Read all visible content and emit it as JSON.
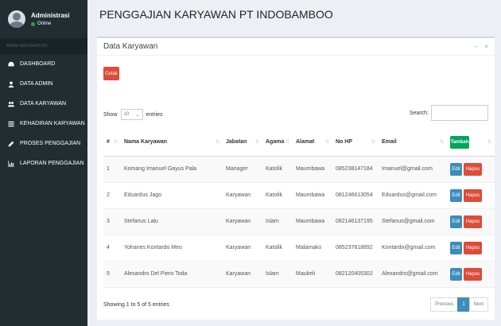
{
  "sidebar": {
    "user": {
      "name": "Administrasi",
      "status": "Online"
    },
    "nav_header": "MAIN NAVIGATION",
    "items": [
      {
        "label": "DASHBOARD",
        "icon": "dashboard-icon"
      },
      {
        "label": "DATA ADMIN",
        "icon": "user-icon"
      },
      {
        "label": "DATA KARYAWAN",
        "icon": "users-icon"
      },
      {
        "label": "KEHADIRAN KARYAWAN",
        "icon": "list-icon"
      },
      {
        "label": "PROSES PENGGAJIAN",
        "icon": "pencil-icon"
      },
      {
        "label": "LAPORAN PENGGAJIAN",
        "icon": "chart-icon"
      }
    ]
  },
  "header": {
    "title": "PENGGAJIAN KARYAWAN PT INDOBAMBOO"
  },
  "box": {
    "title": "Data Karyawan",
    "tools": {
      "collapse": "−",
      "close": "×"
    },
    "cetak_label": "Cetak",
    "entries": {
      "show": "Show",
      "value": "10",
      "suffix": "entries"
    },
    "search_label": "Search:",
    "search_value": ""
  },
  "table": {
    "columns": [
      "#",
      "Nama Karyawan",
      "Jabatan",
      "Agama",
      "Alamat",
      "No HP",
      "Email"
    ],
    "tambah_label": "Tambah",
    "edit_label": "Edit",
    "hapus_label": "Hapus",
    "rows": [
      [
        "1",
        "Komang Imanuel Gayus Pala",
        "Manager",
        "Katolik",
        "Maumbawa",
        "085238147184",
        "Imanuel@gmail.com"
      ],
      [
        "2",
        "Eduardus Jago",
        "Karyawan",
        "Katolik",
        "Maumbawa",
        "081246613054",
        "Eduardus@gmail.com"
      ],
      [
        "3",
        "Stefanus Lalu",
        "Karyawan",
        "Islam",
        "Maumbawa",
        "082146137195",
        "Stefanus@gmail.com"
      ],
      [
        "4",
        "Yohanes Kontardo Meo",
        "Karyawan",
        "Katolik",
        "Malamako",
        "085237818892",
        "Kontardo@gmail.com"
      ],
      [
        "5",
        "Alexandro Del Piero Toda",
        "Karyawan",
        "Islam",
        "Maukeli",
        "082120405302",
        "Alexandro@gmail.com"
      ]
    ]
  },
  "footer": {
    "showing": "Showing 1 to 5 of 5 entries",
    "previous": "Previous",
    "page": "1",
    "next": "Next"
  },
  "colors": {
    "sidebar": "#222d32",
    "primary": "#3c8dbc",
    "danger": "#dd4b39",
    "success": "#00a65a"
  }
}
